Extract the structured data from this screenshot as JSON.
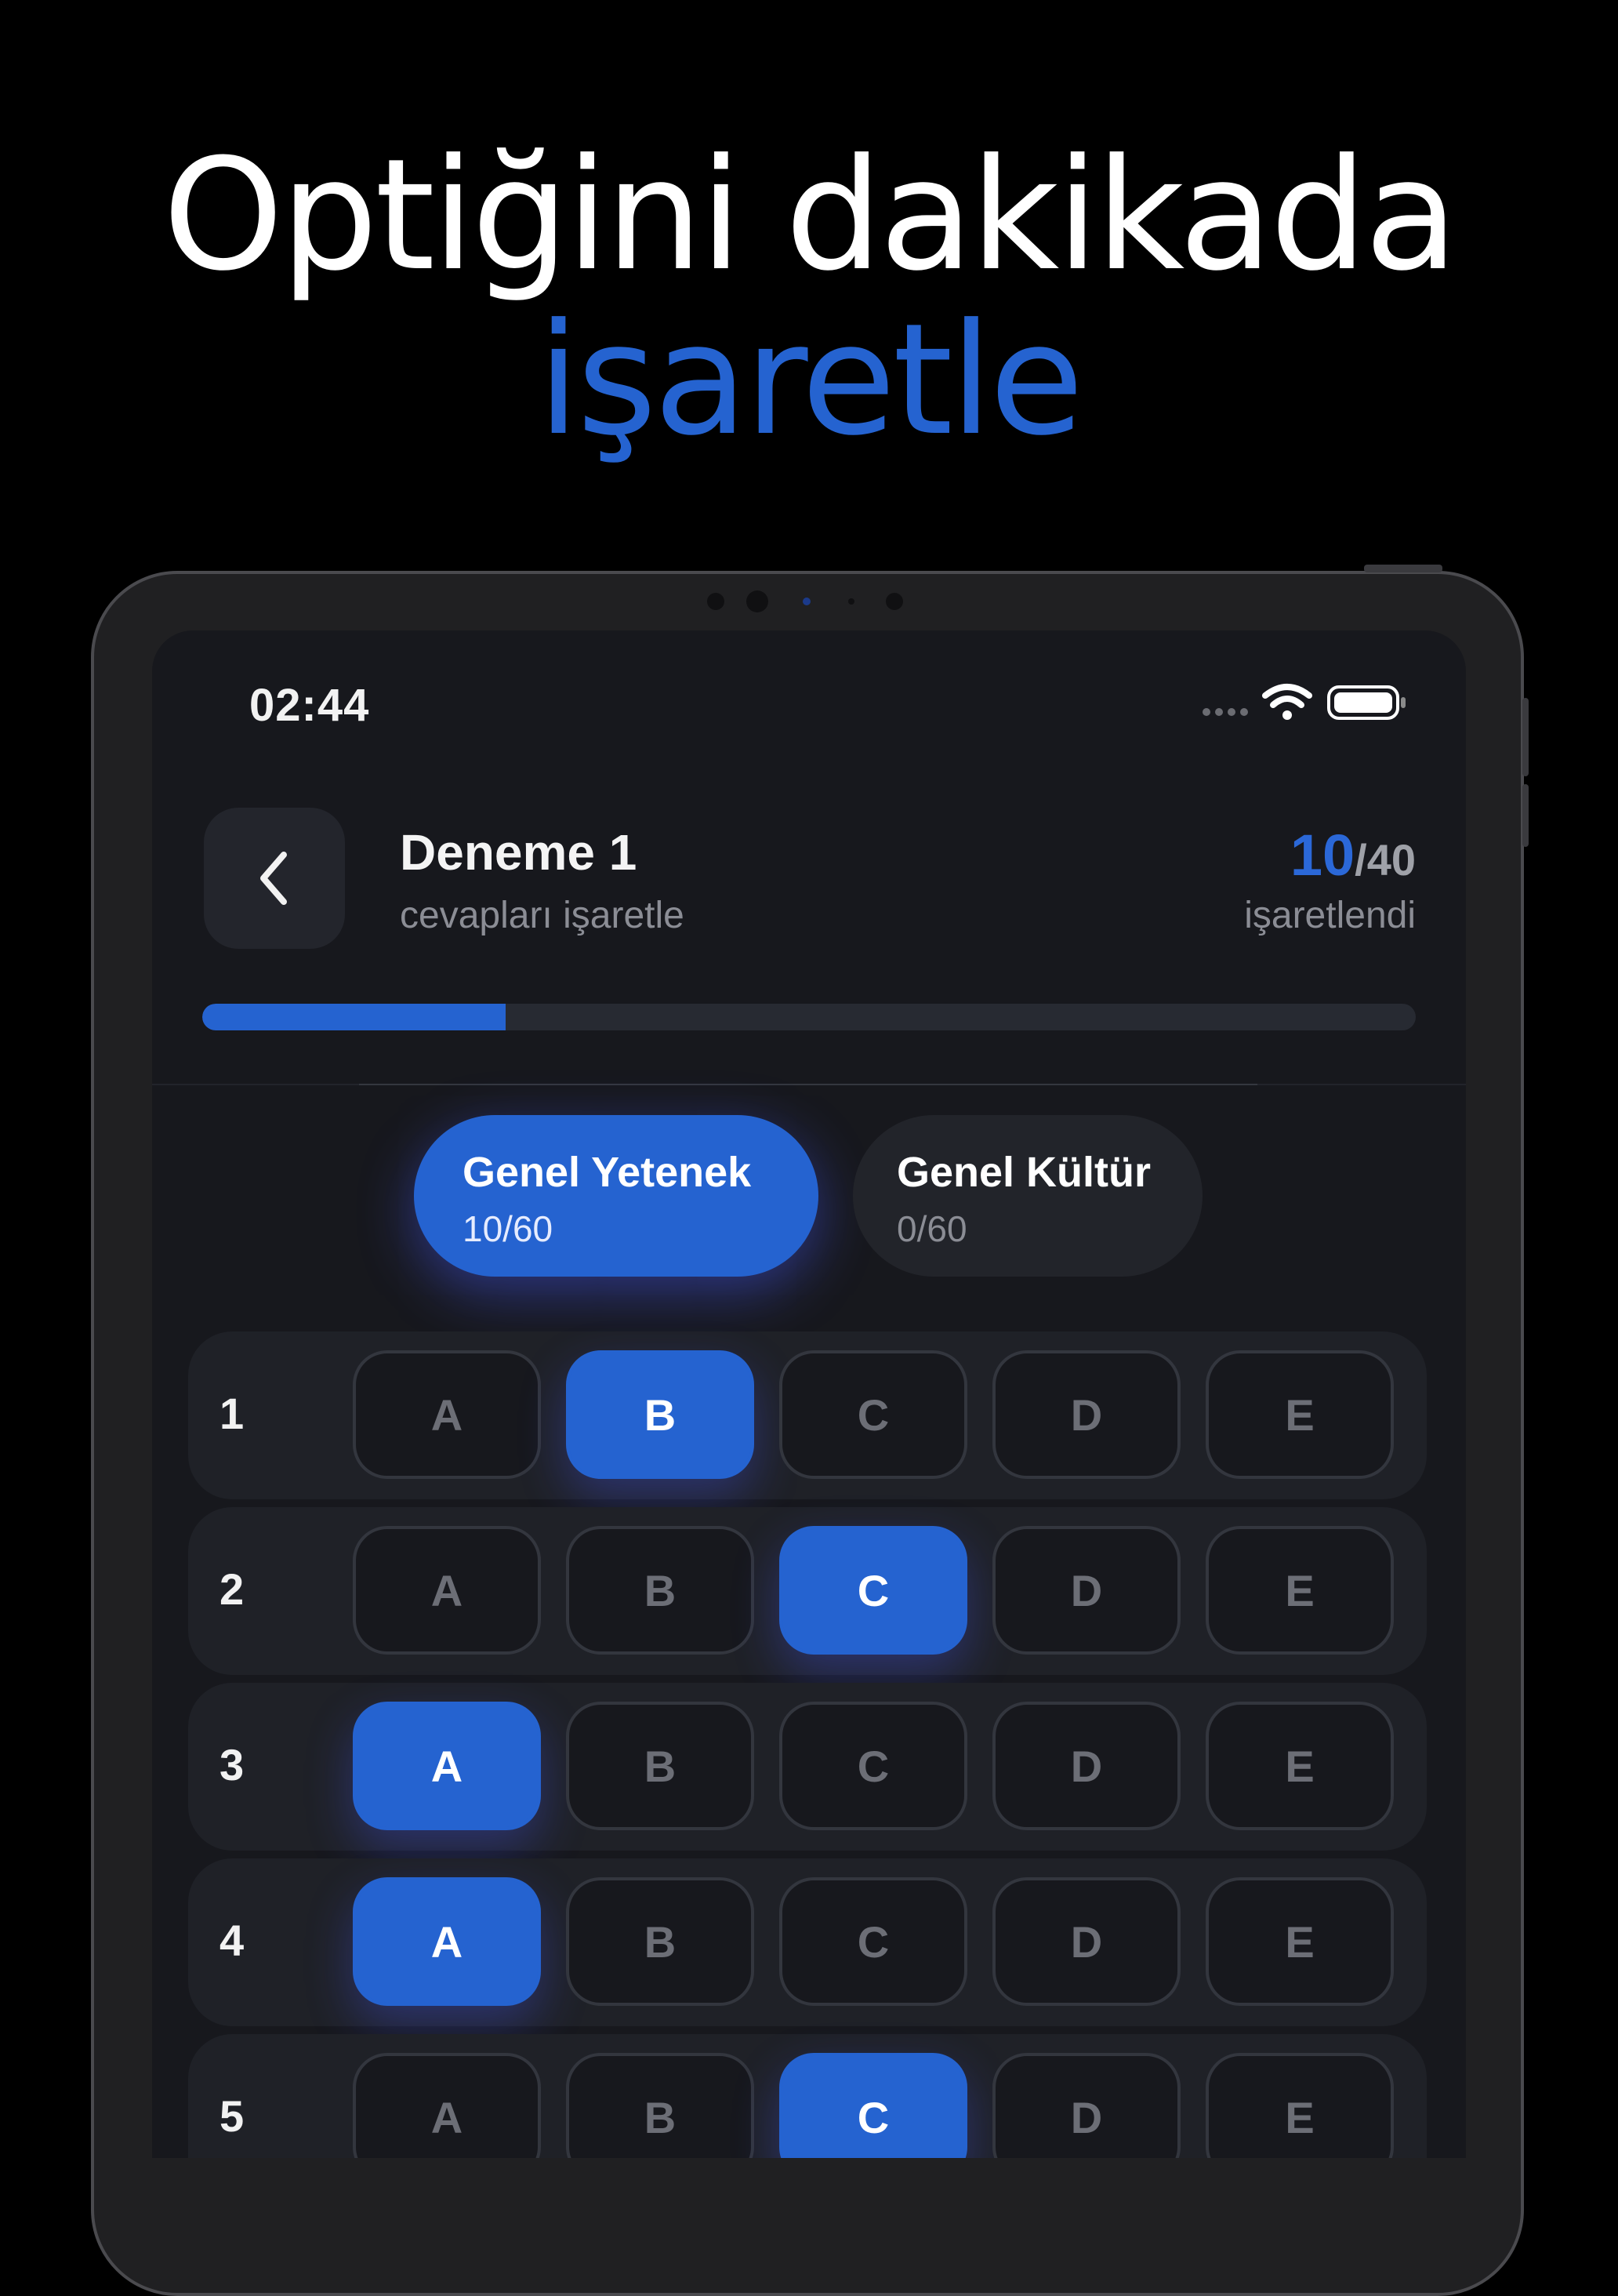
{
  "headline": {
    "line1": "Optiğini dakikada",
    "line2": "işaretle"
  },
  "status_bar": {
    "time": "02:44"
  },
  "header": {
    "back_icon": "chevron-left-icon",
    "title": "Deneme 1",
    "subtitle": "cevapları işaretle",
    "marked_count": "10",
    "marked_total": "/40",
    "marked_label": "işaretlendi",
    "progress": 0.25
  },
  "tabs": [
    {
      "label": "Genel Yetenek",
      "count": "10/60",
      "active": true
    },
    {
      "label": "Genel Kültür",
      "count": "0/60",
      "active": false
    }
  ],
  "options": [
    "A",
    "B",
    "C",
    "D",
    "E"
  ],
  "questions": [
    {
      "number": "1",
      "selected": "B"
    },
    {
      "number": "2",
      "selected": "C"
    },
    {
      "number": "3",
      "selected": "A"
    },
    {
      "number": "4",
      "selected": "A"
    },
    {
      "number": "5",
      "selected": "C"
    }
  ],
  "colors": {
    "accent": "#2563d0",
    "background": "#000000",
    "screen": "#17181d"
  }
}
